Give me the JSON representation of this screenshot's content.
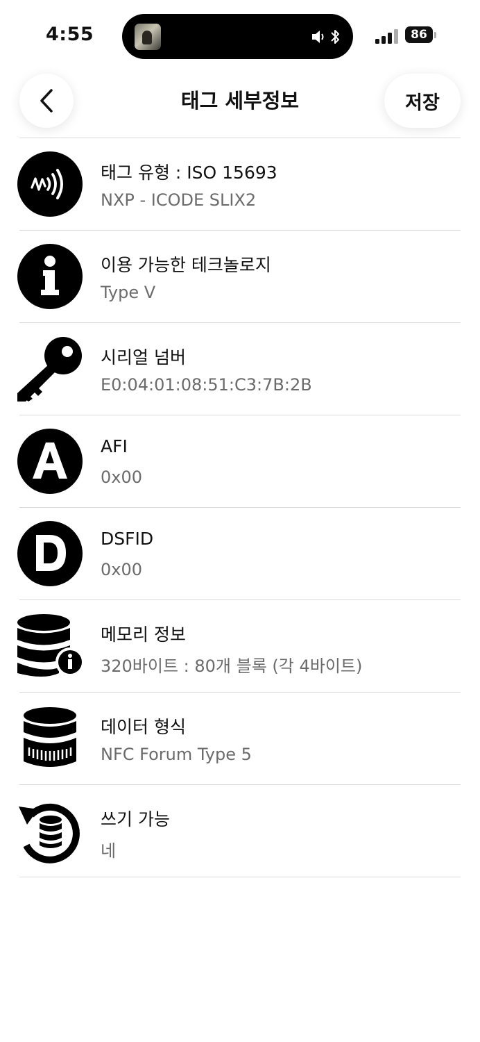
{
  "status_bar": {
    "time": "4:55",
    "battery": "86"
  },
  "nav": {
    "title": "태그 세부정보",
    "save_label": "저장"
  },
  "rows": [
    {
      "title": "태그 유형 : ISO 15693",
      "value": "NXP - ICODE SLIX2",
      "icon": "nfc-waves-icon"
    },
    {
      "title": "이용 가능한 테크놀로지",
      "value": "Type V",
      "icon": "info-icon"
    },
    {
      "title": "시리얼 넘버",
      "value": "E0:04:01:08:51:C3:7B:2B",
      "icon": "key-icon"
    },
    {
      "title": "AFI",
      "value": "0x00",
      "icon": "letter-a-icon"
    },
    {
      "title": "DSFID",
      "value": "0x00",
      "icon": "letter-d-icon"
    },
    {
      "title": "메모리 정보",
      "value": "320바이트 : 80개 블록 (각 4바이트)",
      "icon": "database-info-icon"
    },
    {
      "title": "데이터 형식",
      "value": "NFC Forum Type 5",
      "icon": "coin-stack-icon"
    },
    {
      "title": "쓰기 가능",
      "value": "네",
      "icon": "database-rewrite-icon"
    }
  ]
}
